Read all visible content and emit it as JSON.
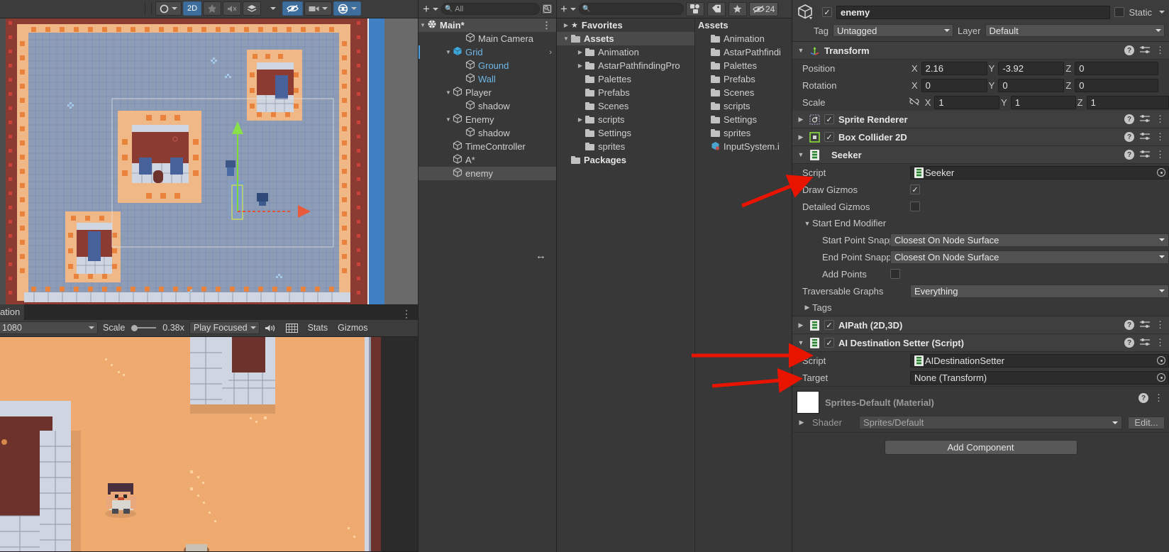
{
  "scene_toolbar": {
    "buttons": [
      {
        "name": "lighting-toggle",
        "label": "○",
        "active": false,
        "caret": true
      },
      {
        "name": "2d-toggle",
        "label": "2D",
        "active": true,
        "caret": false
      },
      {
        "name": "scene-lighting",
        "label": "☄",
        "active": false,
        "caret": false
      },
      {
        "name": "audio-toggle",
        "label": "🔊",
        "active": false,
        "caret": false
      },
      {
        "name": "fx-toggle",
        "label": "☰",
        "active": false,
        "caret": true
      },
      {
        "name": "scene-visibility",
        "label": "👁",
        "active": true,
        "caret": false
      },
      {
        "name": "camera-settings",
        "label": "▬",
        "active": false,
        "caret": true
      },
      {
        "name": "gizmos-toggle",
        "label": "⊕",
        "active": true,
        "caret": true
      }
    ]
  },
  "animation_tab": {
    "label": "ation",
    "kebab": "⋮"
  },
  "game_toolbar": {
    "resolution": "1080",
    "scale_label": "Scale",
    "scale_value": "0.38x",
    "play_mode": "Play Focused",
    "mute_icon": "speaker-icon",
    "aspect_icon": "grid-icon",
    "stats_label": "Stats",
    "gizmos_label": "Gizmos"
  },
  "hierarchy": {
    "add_label": "+",
    "search_placeholder": "All",
    "search_value": "",
    "scene_name": "Main*",
    "items": [
      {
        "label": "Main Camera",
        "depth": 2,
        "twirl": "",
        "icon": "cube-icon",
        "blue": false,
        "selected": false,
        "chevron": false
      },
      {
        "label": "Grid",
        "depth": 1,
        "twirl": "▼",
        "icon": "grid-prefab-icon",
        "blue": true,
        "selected": false,
        "chevron": true,
        "marker": true
      },
      {
        "label": "Ground",
        "depth": 2,
        "twirl": "",
        "icon": "cube-icon",
        "blue": true,
        "selected": false,
        "chevron": false
      },
      {
        "label": "Wall",
        "depth": 2,
        "twirl": "",
        "icon": "cube-icon",
        "blue": true,
        "selected": false,
        "chevron": false
      },
      {
        "label": "Player",
        "depth": 1,
        "twirl": "▼",
        "icon": "cube-icon",
        "blue": false,
        "selected": false,
        "chevron": false
      },
      {
        "label": "shadow",
        "depth": 2,
        "twirl": "",
        "icon": "cube-icon",
        "blue": false,
        "selected": false,
        "chevron": false
      },
      {
        "label": "Enemy",
        "depth": 1,
        "twirl": "▼",
        "icon": "cube-icon",
        "blue": false,
        "selected": false,
        "chevron": false
      },
      {
        "label": "shadow",
        "depth": 2,
        "twirl": "",
        "icon": "cube-icon",
        "blue": false,
        "selected": false,
        "chevron": false
      },
      {
        "label": "TimeController",
        "depth": 1,
        "twirl": "",
        "icon": "cube-icon",
        "blue": false,
        "selected": false,
        "chevron": false
      },
      {
        "label": "A*",
        "depth": 1,
        "twirl": "",
        "icon": "cube-icon",
        "blue": false,
        "selected": false,
        "chevron": false
      },
      {
        "label": "enemy",
        "depth": 1,
        "twirl": "",
        "icon": "cube-icon",
        "blue": false,
        "selected": true,
        "chevron": false
      }
    ]
  },
  "project": {
    "add_label": "+",
    "search_placeholder": "",
    "toolbar_icons": [
      "packages-icon",
      "label-icon",
      "star-icon",
      "hidden-eye-icon"
    ],
    "hidden_count": "24",
    "tree": [
      {
        "label": "Favorites",
        "twirl": "▶",
        "icon": "star-icon",
        "bold": true,
        "selected": false,
        "depth": 0
      },
      {
        "label": "Assets",
        "twirl": "▼",
        "icon": "folder-open-icon",
        "bold": true,
        "selected": true,
        "depth": 0
      },
      {
        "label": "Animation",
        "twirl": "▶",
        "icon": "folder-icon",
        "bold": false,
        "selected": false,
        "depth": 1
      },
      {
        "label": "AstarPathfindingPro",
        "twirl": "▶",
        "icon": "folder-icon",
        "bold": false,
        "selected": false,
        "depth": 1
      },
      {
        "label": "Palettes",
        "twirl": "",
        "icon": "folder-icon",
        "bold": false,
        "selected": false,
        "depth": 1
      },
      {
        "label": "Prefabs",
        "twirl": "",
        "icon": "folder-icon",
        "bold": false,
        "selected": false,
        "depth": 1
      },
      {
        "label": "Scenes",
        "twirl": "",
        "icon": "folder-icon",
        "bold": false,
        "selected": false,
        "depth": 1
      },
      {
        "label": "scripts",
        "twirl": "▶",
        "icon": "folder-icon",
        "bold": false,
        "selected": false,
        "depth": 1
      },
      {
        "label": "Settings",
        "twirl": "",
        "icon": "folder-icon",
        "bold": false,
        "selected": false,
        "depth": 1
      },
      {
        "label": "sprites",
        "twirl": "",
        "icon": "folder-icon",
        "bold": false,
        "selected": false,
        "depth": 1
      },
      {
        "label": "Packages",
        "twirl": "",
        "icon": "folder-icon",
        "bold": true,
        "selected": false,
        "depth": 0
      }
    ],
    "content_header": "Assets",
    "contents": [
      {
        "label": "Animation",
        "icon": "folder-icon"
      },
      {
        "label": "AstarPathfindi",
        "icon": "folder-icon"
      },
      {
        "label": "Palettes",
        "icon": "folder-icon"
      },
      {
        "label": "Prefabs",
        "icon": "folder-icon"
      },
      {
        "label": "Scenes",
        "icon": "folder-icon"
      },
      {
        "label": "scripts",
        "icon": "folder-icon"
      },
      {
        "label": "Settings",
        "icon": "folder-icon"
      },
      {
        "label": "sprites",
        "icon": "folder-icon"
      },
      {
        "label": "InputSystem.i",
        "icon": "asset-icon"
      }
    ]
  },
  "inspector": {
    "object_enabled": true,
    "object_name": "enemy",
    "static_label": "Static",
    "static_checked": false,
    "tag_label": "Tag",
    "tag_value": "Untagged",
    "layer_label": "Layer",
    "layer_value": "Default",
    "transform": {
      "title": "Transform",
      "rows": [
        {
          "name": "Position",
          "x": "2.16",
          "y": "-3.92",
          "z": "0",
          "link": false
        },
        {
          "name": "Rotation",
          "x": "0",
          "y": "0",
          "z": "0",
          "link": false
        },
        {
          "name": "Scale",
          "x": "1",
          "y": "1",
          "z": "1",
          "link": true
        }
      ],
      "axes": [
        "X",
        "Y",
        "Z"
      ]
    },
    "components": [
      {
        "title": "Sprite Renderer",
        "twirl": "▶",
        "checkbox": true,
        "checked": true,
        "icon": "sprite-renderer-icon"
      },
      {
        "title": "Box Collider 2D",
        "twirl": "▶",
        "checkbox": true,
        "checked": true,
        "icon": "box-collider-icon"
      }
    ],
    "seeker": {
      "title": "Seeker",
      "twirl": "▼",
      "icon": "script-icon",
      "script_label": "Script",
      "script_value": "Seeker",
      "draw_gizmos_label": "Draw Gizmos",
      "draw_gizmos_checked": true,
      "detailed_gizmos_label": "Detailed Gizmos",
      "detailed_gizmos_checked": false,
      "start_end_modifier_label": "Start End Modifier",
      "start_point_label": "Start Point Snapping",
      "start_point_value": "Closest On Node Surface",
      "end_point_label": "End Point Snapping",
      "end_point_value": "Closest On Node Surface",
      "add_points_label": "Add Points",
      "add_points_checked": false,
      "traversable_label": "Traversable Graphs",
      "traversable_value": "Everything",
      "tags_label": "Tags"
    },
    "aipath": {
      "title": "AIPath (2D,3D)",
      "twirl": "▶",
      "checked": true,
      "icon": "script-icon"
    },
    "destination_setter": {
      "title": "AI Destination Setter (Script)",
      "twirl": "▼",
      "checked": true,
      "icon": "script-icon",
      "script_label": "Script",
      "script_value": "AIDestinationSetter",
      "target_label": "Target",
      "target_value": "None (Transform)"
    },
    "material": {
      "title": "Sprites-Default (Material)",
      "shader_label": "Shader",
      "shader_value": "Sprites/Default",
      "edit_label": "Edit..."
    },
    "add_component_label": "Add Component"
  },
  "colors": {
    "accent_blue": "#3d6e9e",
    "panel_bg": "#383838",
    "toolbar_bg": "#3c3c3c",
    "field_bg": "#2c2c2c",
    "arrow_red": "#e81400",
    "link_blue": "#6fb7e8"
  },
  "annotations": [
    {
      "name": "arrow-to-seeker",
      "target": "Seeker"
    },
    {
      "name": "arrow-to-aipath",
      "target": "AIPath (2D,3D)"
    },
    {
      "name": "arrow-to-destination-setter",
      "target": "AI Destination Setter (Script)"
    }
  ]
}
